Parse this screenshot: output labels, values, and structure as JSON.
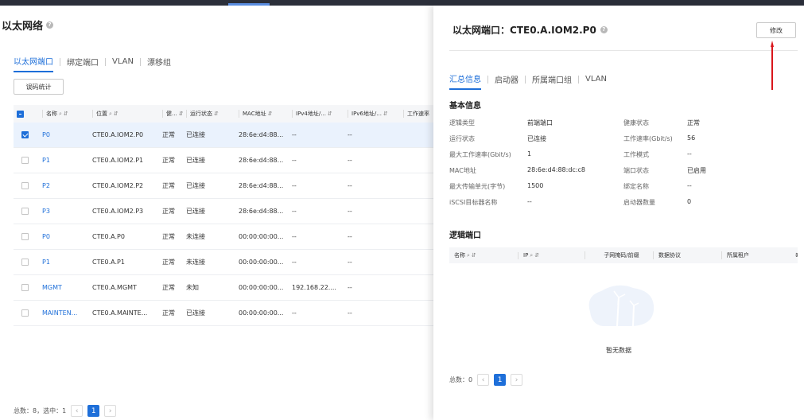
{
  "page": {
    "title": "以太网络",
    "tabs": [
      "以太网端口",
      "绑定端口",
      "VLAN",
      "漂移组"
    ],
    "error_stats_button": "误码统计",
    "columns": [
      "名称",
      "位置",
      "健...",
      "运行状态",
      "MAC地址",
      "IPv4地址/...",
      "IPv6地址/...",
      "工作速率"
    ],
    "rows": [
      {
        "name": "P0",
        "location": "CTE0.A.IOM2.P0",
        "health": "正常",
        "status": "已连接",
        "mac": "28:6e:d4:88...",
        "ipv4": "--",
        "ipv6": "--",
        "selected": true
      },
      {
        "name": "P1",
        "location": "CTE0.A.IOM2.P1",
        "health": "正常",
        "status": "已连接",
        "mac": "28:6e:d4:88...",
        "ipv4": "--",
        "ipv6": "--",
        "selected": false
      },
      {
        "name": "P2",
        "location": "CTE0.A.IOM2.P2",
        "health": "正常",
        "status": "已连接",
        "mac": "28:6e:d4:88...",
        "ipv4": "--",
        "ipv6": "--",
        "selected": false
      },
      {
        "name": "P3",
        "location": "CTE0.A.IOM2.P3",
        "health": "正常",
        "status": "已连接",
        "mac": "28:6e:d4:88...",
        "ipv4": "--",
        "ipv6": "--",
        "selected": false
      },
      {
        "name": "P0",
        "location": "CTE0.A.P0",
        "health": "正常",
        "status": "未连接",
        "mac": "00:00:00:00...",
        "ipv4": "--",
        "ipv6": "--",
        "selected": false
      },
      {
        "name": "P1",
        "location": "CTE0.A.P1",
        "health": "正常",
        "status": "未连接",
        "mac": "00:00:00:00...",
        "ipv4": "--",
        "ipv6": "--",
        "selected": false
      },
      {
        "name": "MGMT",
        "location": "CTE0.A.MGMT",
        "health": "正常",
        "status": "未知",
        "mac": "00:00:00:00...",
        "ipv4": "192.168.22....",
        "ipv6": "--",
        "selected": false
      },
      {
        "name": "MAINTEN...",
        "location": "CTE0.A.MAINTE...",
        "health": "正常",
        "status": "已连接",
        "mac": "00:00:00:00...",
        "ipv4": "--",
        "ipv6": "--",
        "selected": false
      }
    ],
    "footer": "总数：8，选中：1",
    "page_number": "1"
  },
  "panel": {
    "title": "以太网端口：CTE0.A.IOM2.P0",
    "modify_button": "修改",
    "tabs": [
      "汇总信息",
      "启动器",
      "所属端口组",
      "VLAN"
    ],
    "basic_info_title": "基本信息",
    "basic_info": [
      {
        "label": "逻辑类型",
        "value": "前端端口"
      },
      {
        "label": "健康状态",
        "value": "正常"
      },
      {
        "label": "运行状态",
        "value": "已连接"
      },
      {
        "label": "工作速率(Gbit/s)",
        "value": "56"
      },
      {
        "label": "最大工作速率(Gbit/s)",
        "value": "1"
      },
      {
        "label": "工作模式",
        "value": "--"
      },
      {
        "label": "MAC地址",
        "value": "28:6e:d4:88:dc:c8"
      },
      {
        "label": "端口状态",
        "value": "已启用"
      },
      {
        "label": "最大传输单元(字节)",
        "value": "1500"
      },
      {
        "label": "绑定名称",
        "value": "--"
      },
      {
        "label": "iSCSI目标器名称",
        "value": "--"
      },
      {
        "label": "启动器数量",
        "value": "0"
      }
    ],
    "logical_ports_title": "逻辑端口",
    "logical_columns": [
      "名称",
      "IP",
      "子网掩码/前缀",
      "数据协议",
      "所属租户"
    ],
    "empty_text": "暂无数据",
    "footer": "总数：0",
    "page_number": "1"
  },
  "colors": {
    "accent": "#1e6fd9",
    "annotation": "#d9161c"
  }
}
